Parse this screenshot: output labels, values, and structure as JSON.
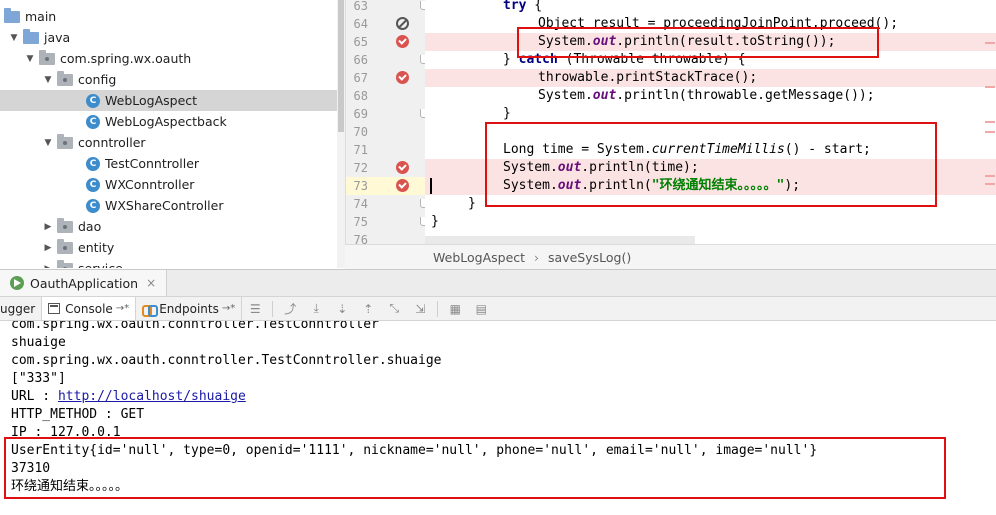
{
  "tree": {
    "items": [
      {
        "label": "main",
        "type": "folder"
      },
      {
        "label": "java",
        "type": "folder"
      },
      {
        "label": "com.spring.wx.oauth",
        "type": "package"
      },
      {
        "label": "config",
        "type": "package"
      },
      {
        "label": "WebLogAspect",
        "type": "class"
      },
      {
        "label": "WebLogAspectback",
        "type": "class"
      },
      {
        "label": "conntroller",
        "type": "package"
      },
      {
        "label": "TestConntroller",
        "type": "class"
      },
      {
        "label": "WXConntroller",
        "type": "class"
      },
      {
        "label": "WXShareController",
        "type": "class"
      },
      {
        "label": "dao",
        "type": "package"
      },
      {
        "label": "entity",
        "type": "package"
      },
      {
        "label": "service",
        "type": "package"
      }
    ],
    "selected_label": "WebLogAspect"
  },
  "editor": {
    "line_numbers": [
      "63",
      "64",
      "65",
      "66",
      "67",
      "68",
      "69",
      "70",
      "71",
      "72",
      "73",
      "74",
      "75",
      "76"
    ],
    "class_icon_letter": "C",
    "code": {
      "try_kw": "try",
      "obj_decl": "Object result = proceedingJoinPoint.proceed();",
      "sys": "System.",
      "out": "out",
      "println_result": ".println(result.toString());",
      "close_catch": "} ",
      "catch_kw": "catch",
      "catch_rest": " (Throwable throwable) {",
      "print_stack": "throwable.printStackTrace();",
      "println_msg": ".println(throwable.getMessage());",
      "brace": "}",
      "long_decl_a": "Long time = System.",
      "current_millis": "currentTimeMillis",
      "long_decl_b": "() - start;",
      "println_time": ".println(time);",
      "println_open": ".println(",
      "end_string": "\"环绕通知结束。。。。。\"",
      "println_close": ");"
    }
  },
  "breadcrumb": {
    "class": "WebLogAspect",
    "separator": "›",
    "method": "saveSysLog()"
  },
  "run_window": {
    "tab_label": "OauthApplication",
    "close": "×",
    "toolbar_tabs": {
      "debugger": "ugger",
      "console": "Console",
      "endpoints": "Endpoints",
      "pin": "→*"
    }
  },
  "console": {
    "lines": [
      "com.spring.wx.oauth.conntroller.TestConntroller",
      "shuaige",
      "com.spring.wx.oauth.conntroller.TestConntroller.shuaige",
      "[\"333\"]"
    ],
    "url_prefix": "URL : ",
    "url": "http://localhost/shuaige",
    "http_method": "HTTP_METHOD : GET",
    "ip": "IP : 127.0.0.1",
    "user_entity": "UserEntity{id='null', type=0, openid='1111', nickname='null', phone='null', email='null', image='null'}",
    "time_value": "37310",
    "end_message": "环绕通知结束。。。。。"
  },
  "colors": {
    "highlight_box": "#e01010",
    "breakpoint": "#d9534f",
    "breakpoint_line_bg": "#fbe3e4",
    "keyword": "#000080",
    "field": "#660e7a",
    "string": "#008000"
  }
}
